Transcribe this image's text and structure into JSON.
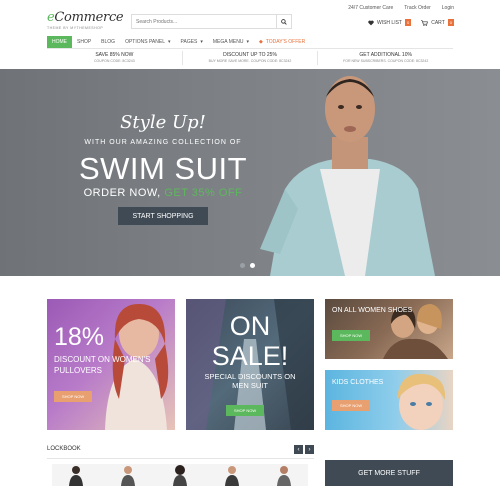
{
  "header": {
    "logo_main_e": "e",
    "logo_main_rest": "Commerce",
    "logo_sub": "THEME BY MYTHEMESHOP",
    "search_placeholder": "Search Products...",
    "top_links": [
      "24/7 Customer Care",
      "Track Order",
      "Login"
    ],
    "wishlist_label": "WISH LIST",
    "wishlist_count": "0",
    "cart_label": "CART",
    "cart_count": "0"
  },
  "nav": {
    "items": [
      "HOME",
      "SHOP",
      "BLOG",
      "OPTIONS PANEL",
      "PAGES",
      "MEGA MENU",
      "TODAY'S OFFER"
    ]
  },
  "promo": [
    {
      "title": "SAVE 85% NOW",
      "sub": "COUPON CODE: 8C3243"
    },
    {
      "title": "DISCOUNT UP TO 25%",
      "sub": "BUY MORE SAVE MORE. COUPON CODE: 8C3242"
    },
    {
      "title": "GET ADDITIONAL 10%",
      "sub": "FOR NEW SUBSCRIBERS. COUPON CODE: 8C3242"
    }
  ],
  "hero": {
    "heading": "Style Up!",
    "subheading": "WITH OUR AMAZING COLLECTION OF",
    "title": "SWIM SUIT",
    "order_prefix": "ORDER NOW,",
    "order_highlight": "GET 35% OFF",
    "button": "START SHOPPING"
  },
  "cards": {
    "c1_pct": "18%",
    "c1_line1": "DISCOUNT ON WOMEN'S",
    "c1_line2": "PULLOVERS",
    "c1_btn": "SHOP NOW",
    "c2_on": "ON",
    "c2_sale": "SALE!",
    "c2_desc1": "SPECIAL DISCOUNTS ON",
    "c2_desc2": "MEN SUIT",
    "c2_btn": "SHOP NOW",
    "c3_title": "ON ALL WOMEN SHOES",
    "c3_btn": "SHOP NOW",
    "c4_title": "KIDS CLOTHES",
    "c4_btn": "SHOP NOW"
  },
  "lockbook": {
    "title": "LOCKBOOK",
    "prev": "‹",
    "next": "›"
  },
  "more_box": "GET MORE STUFF",
  "colors": {
    "accent": "#5cb85c",
    "orange": "#e8713c",
    "dark": "#3f4a54"
  }
}
